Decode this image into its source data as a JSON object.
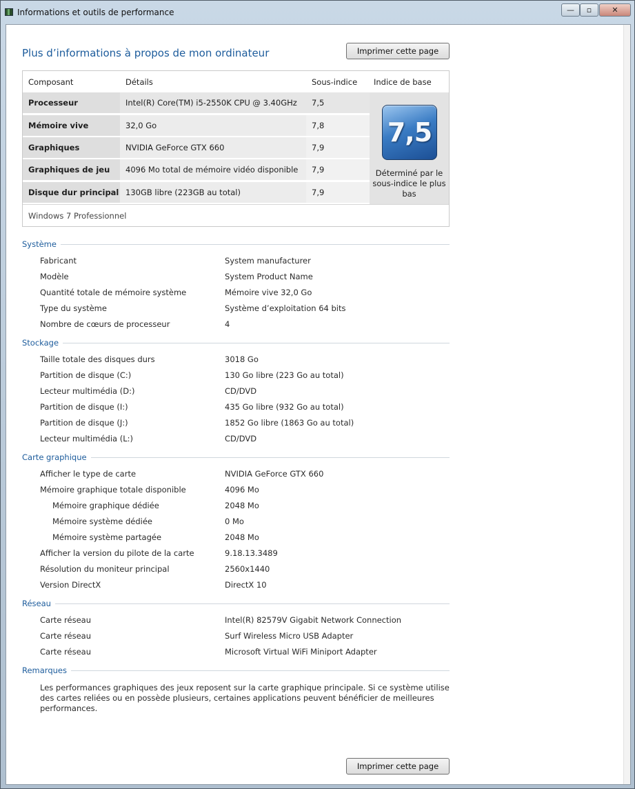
{
  "window": {
    "title": "Informations et outils de performance",
    "controls": {
      "minimize": "—",
      "maximize": "▫",
      "close": "✕"
    }
  },
  "page": {
    "title": "Plus d’informations à propos de mon ordinateur",
    "print_label": "Imprimer cette page"
  },
  "score": {
    "headers": {
      "component": "Composant",
      "details": "Détails",
      "subscore": "Sous-indice",
      "base": "Indice de base"
    },
    "rows": [
      {
        "component": "Processeur",
        "details": "Intel(R) Core(TM) i5-2550K CPU @ 3.40GHz",
        "subscore": "7,5"
      },
      {
        "component": "Mémoire vive",
        "details": "32,0 Go",
        "subscore": "7,8"
      },
      {
        "component": "Graphiques",
        "details": "NVIDIA GeForce GTX 660",
        "subscore": "7,9"
      },
      {
        "component": "Graphiques de jeu",
        "details": "4096 Mo total de mémoire vidéo disponible",
        "subscore": "7,9"
      },
      {
        "component": "Disque dur principal",
        "details": "130GB libre (223GB au total)",
        "subscore": "7,9"
      }
    ],
    "base_value": "7,5",
    "base_caption": "Déterminé par le sous-indice le plus bas",
    "os": "Windows 7 Professionnel",
    "badge_color": "#3a7cc4"
  },
  "sections": {
    "systeme": {
      "title": "Système",
      "items": [
        {
          "key": "Fabricant",
          "value": "System manufacturer"
        },
        {
          "key": "Modèle",
          "value": "System Product Name"
        },
        {
          "key": "Quantité totale de mémoire système",
          "value": "Mémoire vive 32,0 Go"
        },
        {
          "key": "Type du système",
          "value": "Système d’exploitation 64 bits"
        },
        {
          "key": "Nombre de cœurs de processeur",
          "value": "4"
        }
      ]
    },
    "stockage": {
      "title": "Stockage",
      "items": [
        {
          "key": "Taille totale des disques durs",
          "value": "3018 Go"
        },
        {
          "key": "Partition de disque (C:)",
          "value": "130 Go libre (223 Go au total)"
        },
        {
          "key": "Lecteur multimédia (D:)",
          "value": "CD/DVD"
        },
        {
          "key": "Partition de disque (I:)",
          "value": "435 Go libre (932 Go au total)"
        },
        {
          "key": "Partition de disque (J:)",
          "value": "1852 Go libre (1863 Go au total)"
        },
        {
          "key": "Lecteur multimédia (L:)",
          "value": "CD/DVD"
        }
      ]
    },
    "graphique": {
      "title": "Carte graphique",
      "items": [
        {
          "key": "Afficher le type de carte",
          "value": "NVIDIA GeForce GTX 660"
        },
        {
          "key": "Mémoire graphique totale disponible",
          "value": "4096 Mo"
        },
        {
          "key": "Mémoire graphique dédiée",
          "value": "2048 Mo"
        },
        {
          "key": "Mémoire système dédiée",
          "value": "0 Mo"
        },
        {
          "key": "Mémoire système partagée",
          "value": "2048 Mo"
        },
        {
          "key": "Afficher la version du pilote de la carte",
          "value": "9.18.13.3489"
        },
        {
          "key": "Résolution du moniteur principal",
          "value": "2560x1440"
        },
        {
          "key": "Version DirectX",
          "value": "DirectX 10"
        }
      ]
    },
    "reseau": {
      "title": "Réseau",
      "items": [
        {
          "key": "Carte réseau",
          "value": "Intel(R) 82579V Gigabit Network Connection"
        },
        {
          "key": "Carte réseau",
          "value": "Surf Wireless Micro USB Adapter"
        },
        {
          "key": "Carte réseau",
          "value": "Microsoft Virtual WiFi Miniport Adapter"
        }
      ]
    },
    "remarques": {
      "title": "Remarques",
      "text": "Les performances graphiques des jeux reposent sur la carte graphique principale. Si ce système utilise des cartes reliées ou en possède plusieurs, certaines applications peuvent bénéficier de meilleures performances."
    }
  },
  "colors": {
    "accent": "#1d5c9c",
    "section_line": "#cfd6dd"
  }
}
